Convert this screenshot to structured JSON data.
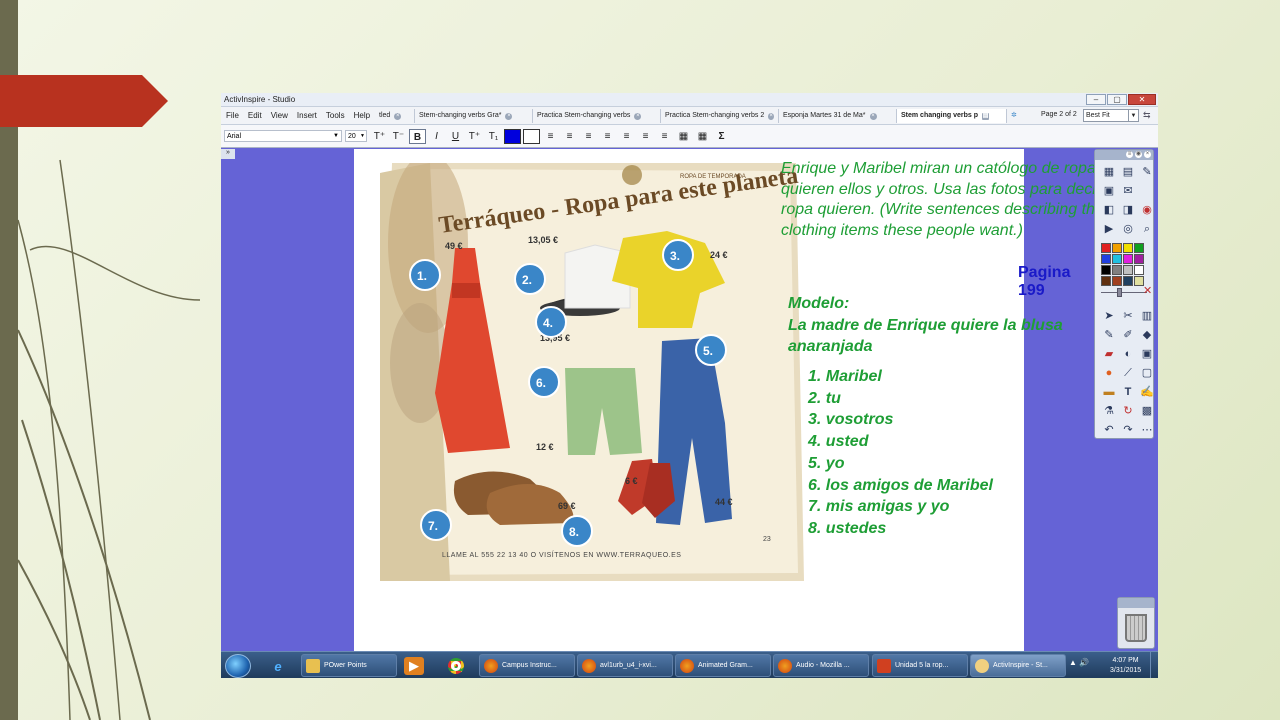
{
  "app": {
    "title": "ActivInspire - Studio",
    "window_min": "–",
    "window_max": "▢",
    "window_close": "✕"
  },
  "menu": [
    "File",
    "Edit",
    "View",
    "Insert",
    "Tools",
    "Help"
  ],
  "tabs": [
    {
      "label": "tled"
    },
    {
      "label": "Stem-changing verbs Gra*"
    },
    {
      "label": "Practica Stem-changing verbs"
    },
    {
      "label": "Practica Stem-changing verbs 2"
    },
    {
      "label": "Esponja Martes 31 de Ma*"
    },
    {
      "label": "Stem changing verbs p",
      "active": true
    }
  ],
  "page_info": "Page 2 of 2",
  "zoom": "Best Fit",
  "format": {
    "font": "Arial",
    "size": "20",
    "buttons": [
      "T⁺",
      "T⁻",
      "B",
      "I",
      "U",
      "T⁺",
      "T₁",
      "",
      "",
      "≡",
      "≡",
      "≡",
      "≡",
      "≡",
      "≡",
      "≡",
      "▦",
      "▦",
      "Σ"
    ]
  },
  "catalog": {
    "title": "Terráqueo - Ropa para este planeta",
    "badge": "ROPA DE TEMPORADA",
    "footer": "LLAME AL 555 22 13 40  O VISÍTENOS EN WWW.TERRAQUEO.ES",
    "page_num": "23",
    "prices": [
      "49 €",
      "13,05 €",
      "24 €",
      "13,95 €",
      "12 €",
      "69 €",
      "6 €",
      "44 €"
    ],
    "numbers": [
      "1.",
      "2.",
      "3.",
      "4.",
      "5.",
      "6.",
      "7.",
      "8."
    ]
  },
  "instructions": "Enrique y Maribel miran un católogo de ropa que quieren ellos y otros. Usa las fotos para decir que ropa quieren.  (Write sentences describing the clothing items these people want.)",
  "pagina": "Pagina 199",
  "tick": "`",
  "modelo": {
    "heading": "Modelo:",
    "text": "La madre de Enrique quiere la blusa anaranjada"
  },
  "items": [
    "1. Maribel",
    "2. tu",
    "3. vosotros",
    "4. usted",
    "5. yo",
    "6. los amigos de Maribel",
    "7. mis amigas y yo",
    "8. ustedes"
  ],
  "palette": [
    "#e02020",
    "#f0a000",
    "#f0e000",
    "#10a020",
    "#2040e0",
    "#20c0e0",
    "#e020e0",
    "#a020a0",
    "#000000",
    "#808080",
    "#c0c0c0",
    "#ffffff",
    "#603010",
    "#a04020",
    "#204060",
    "#e0e0a0"
  ],
  "taskbar": {
    "items": [
      {
        "label": "POwer Points"
      },
      {
        "label": "Campus Instruc..."
      },
      {
        "label": "avl1urb_u4_i-xvi..."
      },
      {
        "label": "Animated Gram..."
      },
      {
        "label": "Audio - Mozilla ..."
      },
      {
        "label": "Unidad 5 la rop..."
      },
      {
        "label": "ActivInspire - St..."
      }
    ],
    "tray": "▲  🔊",
    "time": "4:07 PM",
    "date": "3/31/2015"
  },
  "colors": {
    "instruction_green": "#1e9e35",
    "pagina_blue": "#1a1ac8",
    "workspace_purple": "#6563d6",
    "accent_red": "#b8321f",
    "number_badge_blue": "#3a86c8"
  }
}
